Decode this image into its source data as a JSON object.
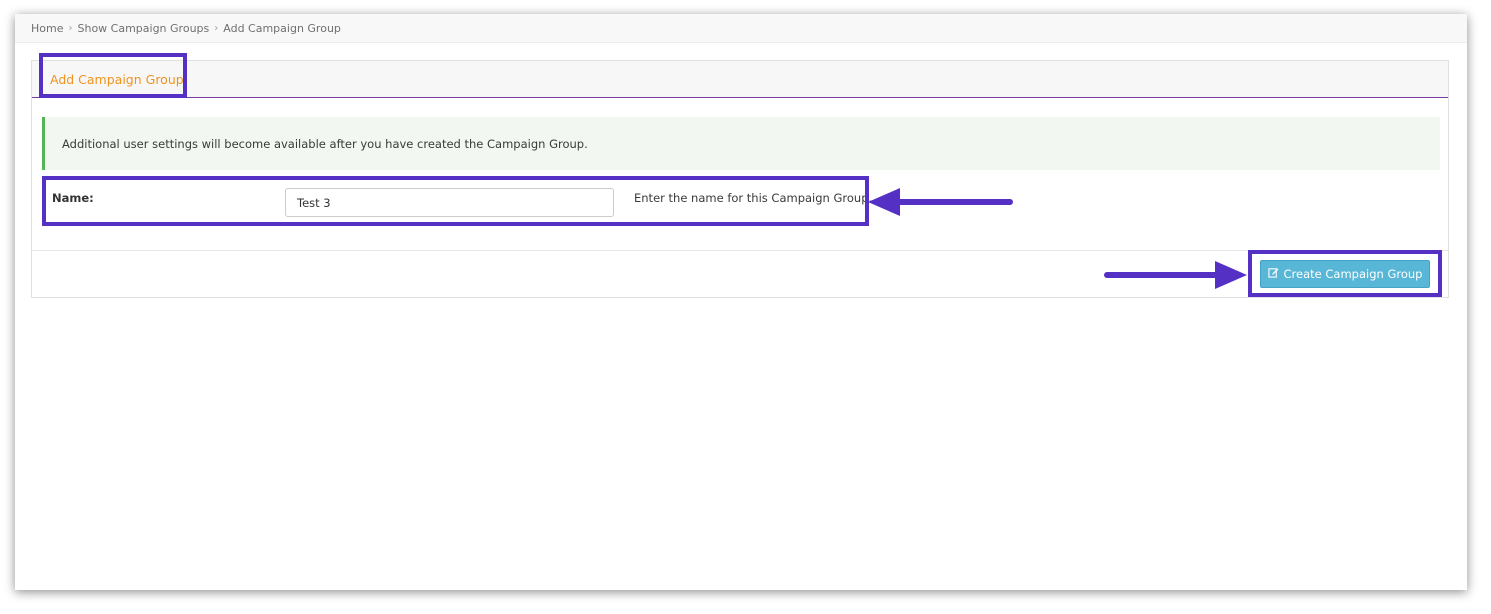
{
  "breadcrumb": {
    "items": [
      "Home",
      "Show Campaign Groups",
      "Add Campaign Group"
    ],
    "separator": "›"
  },
  "panel": {
    "title": "Add Campaign Group",
    "alert_text": "Additional user settings will become available after you have created the Campaign Group."
  },
  "form": {
    "name_label": "Name:",
    "name_value": "Test 3",
    "name_help": "Enter the name for this Campaign Group."
  },
  "footer": {
    "create_button_label": "Create Campaign Group",
    "create_button_icon": "edit-icon"
  },
  "colors": {
    "title_orange": "#f0931e",
    "header_underline": "#7a3aa6",
    "alert_bg": "#f2f7f1",
    "alert_border": "#57b557",
    "button_blue": "#58b6d6",
    "annotation_purple": "#5530c4"
  }
}
